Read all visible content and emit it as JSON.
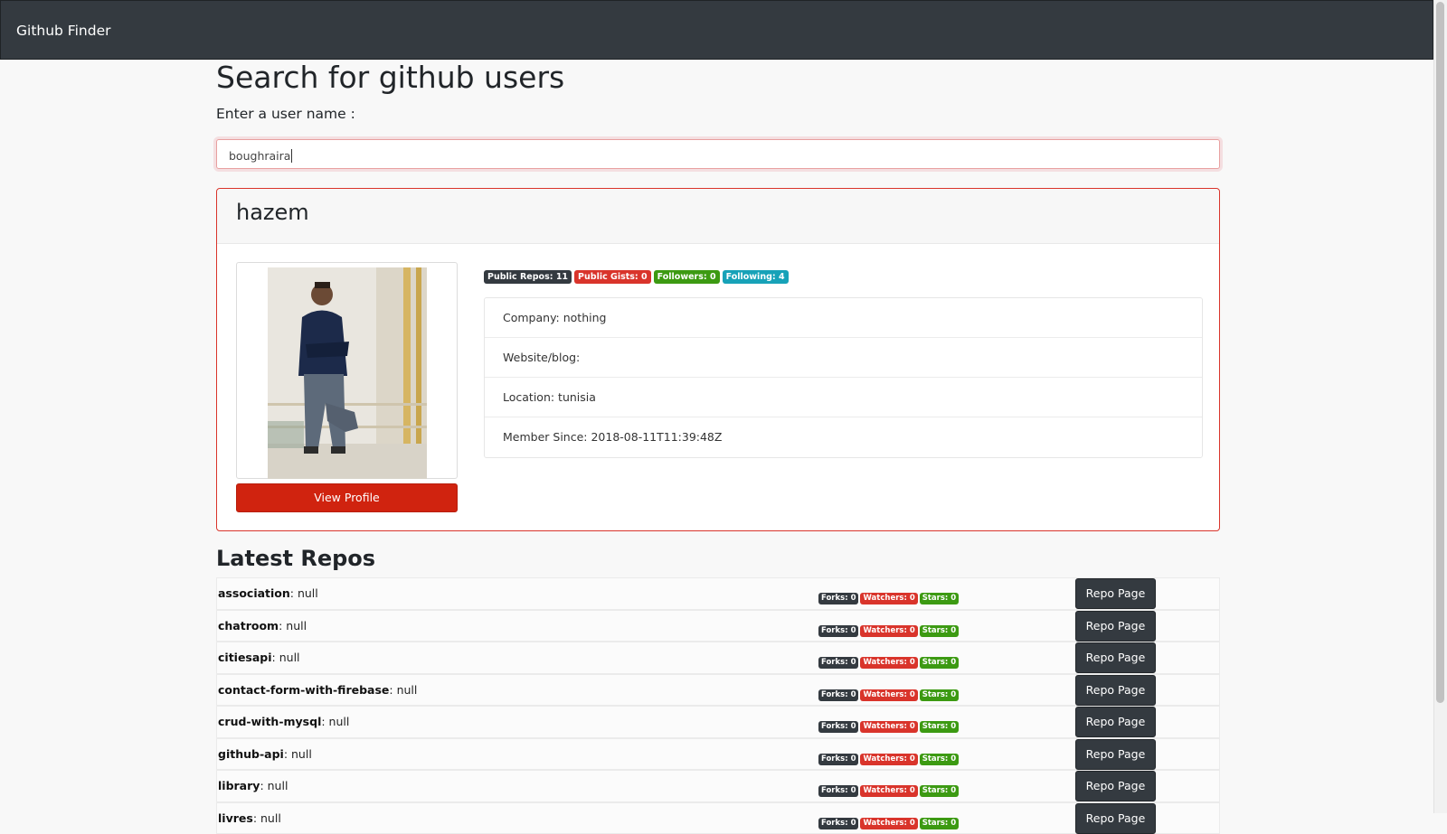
{
  "navbar": {
    "brand": "Github Finder"
  },
  "search": {
    "title": "Search for github users",
    "label": "Enter a user name :",
    "value": "boughraira"
  },
  "profile": {
    "name": "hazem",
    "view_profile_label": "View Profile",
    "badges": {
      "public_repos": "Public Repos: 11",
      "public_gists": "Public Gists: 0",
      "followers": "Followers: 0",
      "following": "Following: 4"
    },
    "info": {
      "company": "Company: nothing",
      "website": "Website/blog:",
      "location": "Location: tunisia",
      "member_since": "Member Since: 2018-08-11T11:39:48Z"
    }
  },
  "repos": {
    "title": "Latest Repos",
    "button_label": "Repo Page",
    "items": [
      {
        "name": "association",
        "desc": ": null",
        "forks": "Forks: 0",
        "watchers": "Watchers: 0",
        "stars": "Stars: 0"
      },
      {
        "name": "chatroom",
        "desc": ": null",
        "forks": "Forks: 0",
        "watchers": "Watchers: 0",
        "stars": "Stars: 0"
      },
      {
        "name": "citiesapi",
        "desc": ": null",
        "forks": "Forks: 0",
        "watchers": "Watchers: 0",
        "stars": "Stars: 0"
      },
      {
        "name": "contact-form-with-firebase",
        "desc": ": null",
        "forks": "Forks: 0",
        "watchers": "Watchers: 0",
        "stars": "Stars: 0"
      },
      {
        "name": "crud-with-mysql",
        "desc": ": null",
        "forks": "Forks: 0",
        "watchers": "Watchers: 0",
        "stars": "Stars: 0"
      },
      {
        "name": "github-api",
        "desc": ": null",
        "forks": "Forks: 0",
        "watchers": "Watchers: 0",
        "stars": "Stars: 0"
      },
      {
        "name": "library",
        "desc": ": null",
        "forks": "Forks: 0",
        "watchers": "Watchers: 0",
        "stars": "Stars: 0"
      },
      {
        "name": "livres",
        "desc": ": null",
        "forks": "Forks: 0",
        "watchers": "Watchers: 0",
        "stars": "Stars: 0"
      }
    ]
  },
  "colors": {
    "navbar": "#343a40",
    "danger": "#d9342b",
    "success": "#3c9a12",
    "info": "#17a2b8",
    "dark": "#343a40"
  }
}
